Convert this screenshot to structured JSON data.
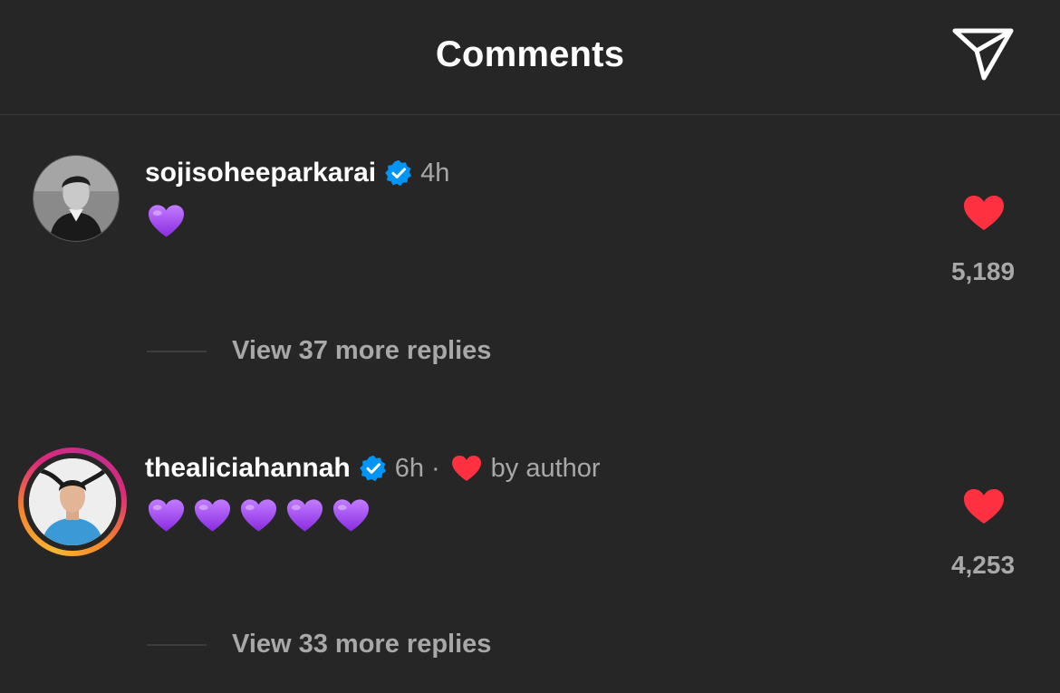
{
  "header": {
    "title": "Comments",
    "share_icon": "paper-plane-icon"
  },
  "comments": [
    {
      "username": "sojisoheeparkarai",
      "verified": true,
      "time": "4h",
      "liked_by_author": false,
      "body": "💜",
      "like_count": "5,189",
      "view_replies": "View 37 more replies",
      "avatar_style": "plain"
    },
    {
      "username": "thealiciahannah",
      "verified": true,
      "time": "6h",
      "separator": "·",
      "liked_by_author": true,
      "liked_by_author_text": "by author",
      "body": "💜💜💜💜💜",
      "like_count": "4,253",
      "view_replies": "View 33 more replies",
      "avatar_style": "story-ring"
    }
  ],
  "colors": {
    "background": "#262626",
    "text_primary": "#ffffff",
    "text_secondary": "#a8a8a8",
    "like_red": "#ff3040",
    "verified_blue": "#0095f6",
    "emoji_purple": "#a24cf0"
  }
}
